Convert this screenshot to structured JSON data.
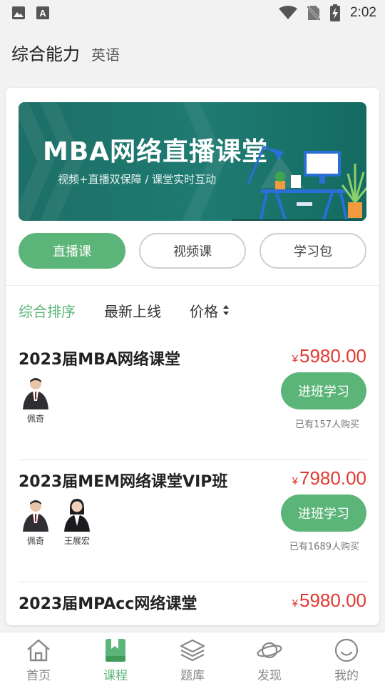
{
  "status_bar": {
    "time": "2:02",
    "icons": [
      "image-icon",
      "font-a-icon",
      "wifi-icon",
      "no-sim-icon",
      "battery-charging-icon"
    ]
  },
  "header": {
    "title": "综合能力",
    "subtitle": "英语"
  },
  "banner": {
    "title": "MBA网络直播课堂",
    "subtitle": "视频+直播双保障 / 课堂实时互动"
  },
  "course_types": [
    {
      "label": "直播课",
      "active": true
    },
    {
      "label": "视频课",
      "active": false
    },
    {
      "label": "学习包",
      "active": false
    }
  ],
  "sort_options": {
    "comprehensive": "综合排序",
    "newest": "最新上线",
    "price": "价格"
  },
  "courses": [
    {
      "title": "2023届MBA网络课堂",
      "currency": "¥",
      "price": "5980.00",
      "teachers": [
        {
          "name": "佩奇"
        }
      ],
      "button": "进班学习",
      "bought": "已有157人购买"
    },
    {
      "title": "2023届MEM网络课堂VIP班",
      "currency": "¥",
      "price": "7980.00",
      "teachers": [
        {
          "name": "佩奇"
        },
        {
          "name": "王展宏"
        }
      ],
      "button": "进班学习",
      "bought": "已有1689人购买"
    },
    {
      "title": "2023届MPAcc网络课堂",
      "currency": "¥",
      "price": "5980.00"
    }
  ],
  "bottom_nav": [
    {
      "label": "首页",
      "icon": "home-icon"
    },
    {
      "label": "课程",
      "icon": "book-icon",
      "active": true
    },
    {
      "label": "题库",
      "icon": "layers-icon"
    },
    {
      "label": "发现",
      "icon": "planet-icon"
    },
    {
      "label": "我的",
      "icon": "smiley-icon"
    }
  ],
  "colors": {
    "accent": "#5cb578",
    "price": "#e03a30",
    "banner": "#1f7b72"
  }
}
